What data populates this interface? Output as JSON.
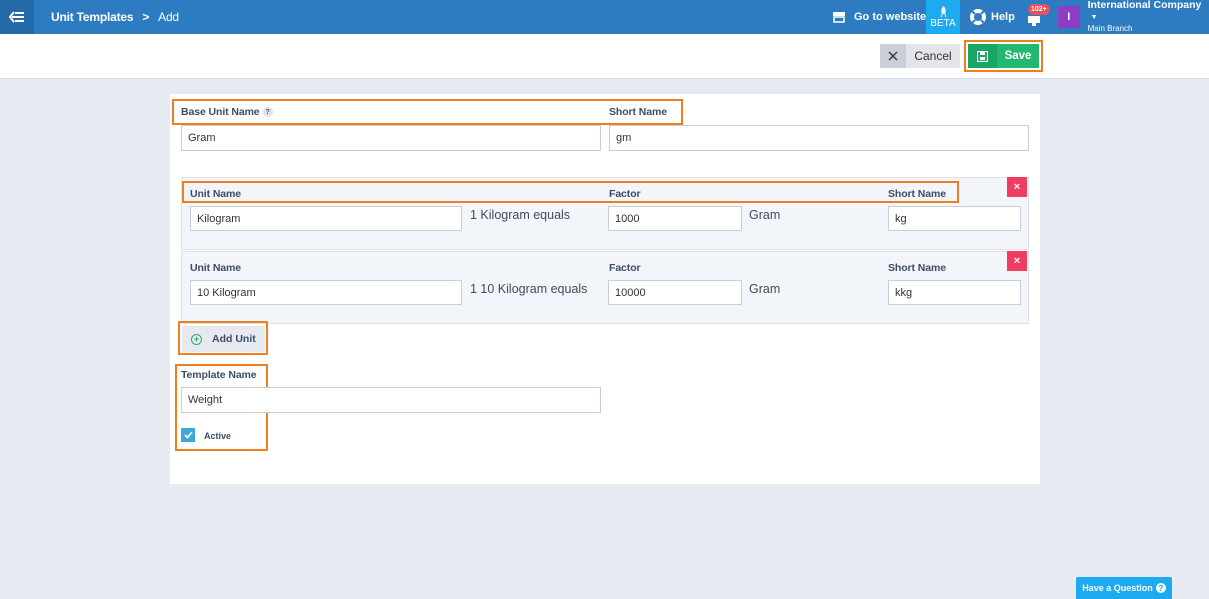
{
  "breadcrumb": {
    "parent": "Unit Templates",
    "separator": ">",
    "current": "Add"
  },
  "topbar": {
    "goto_website": "Go to website",
    "beta": "BETA",
    "help": "Help",
    "notifications_badge": "102+",
    "company_initial": "I",
    "company_name": "International Company",
    "branch": "Main Branch"
  },
  "actions": {
    "cancel": "Cancel",
    "save": "Save"
  },
  "form": {
    "base_unit_label": "Base Unit Name",
    "base_unit_help": "?",
    "base_unit_value": "Gram",
    "short_name_label": "Short Name",
    "short_name_value": "gm",
    "units": [
      {
        "unit_label": "Unit Name",
        "unit_value": "Kilogram",
        "equals_text": "1 Kilogram equals",
        "factor_label": "Factor",
        "factor_value": "1000",
        "base_text": "Gram",
        "short_label": "Short Name",
        "short_value": "kg",
        "remove": "×"
      },
      {
        "unit_label": "Unit Name",
        "unit_value": "10 Kilogram",
        "equals_text": "1 10 Kilogram equals",
        "factor_label": "Factor",
        "factor_value": "10000",
        "base_text": "Gram",
        "short_label": "Short Name",
        "short_value": "kkg",
        "remove": "×"
      }
    ],
    "add_unit": "Add Unit",
    "template_name_label": "Template Name",
    "template_name_value": "Weight",
    "active_label": "Active",
    "active_checked": true
  },
  "have_question": "Have a Question",
  "colors": {
    "topbar": "#2d7bc0",
    "beta": "#1eaaf0",
    "save": "#21b970",
    "remove": "#ef3d62",
    "highlight": "#f07e1f",
    "avatar": "#8c3fc5"
  }
}
